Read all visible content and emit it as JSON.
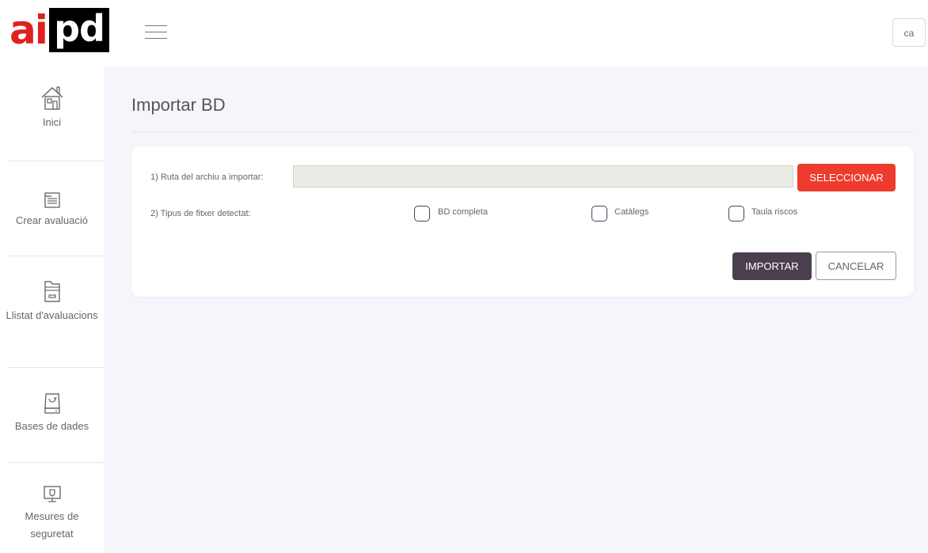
{
  "header": {
    "logo_left": "ai",
    "logo_right": "pd",
    "language": "ca"
  },
  "sidebar": {
    "items": [
      {
        "label": "Inici",
        "icon": "home-icon"
      },
      {
        "label": "Crear avaluació",
        "icon": "form-icon"
      },
      {
        "label": "Llistat d'avaluacions",
        "icon": "folder-list-icon"
      },
      {
        "label": "Bases de dades",
        "icon": "database-drive-icon"
      },
      {
        "label": "Mesures de seguretat",
        "icon": "monitor-shield-icon"
      }
    ]
  },
  "main": {
    "title": "Importar BD",
    "path_label": "1) Ruta del archiu a importar:",
    "path_value": "",
    "select_label": "SELECCIONAR",
    "type_label": "2) Tipus de fitxer detectat:",
    "options": [
      {
        "label": "BD completa",
        "checked": false
      },
      {
        "label": "Catàlegs",
        "checked": false
      },
      {
        "label": "Taula riscos",
        "checked": false
      }
    ],
    "import_label": "IMPORTAR",
    "cancel_label": "CANCELAR"
  },
  "colors": {
    "brand_red": "#e0201e",
    "select_button": "#ee3b2e",
    "import_button": "#4a3f4c",
    "background": "#f4f6fb"
  }
}
